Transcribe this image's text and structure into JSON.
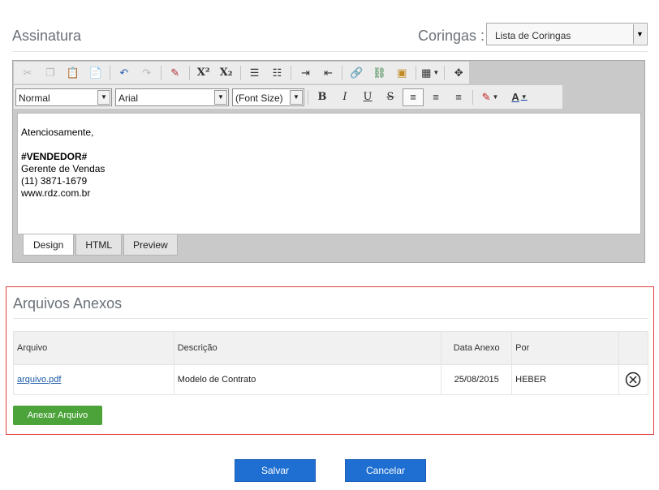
{
  "signature": {
    "title": "Assinatura",
    "coringas_label": "Coringas :",
    "coringas_select": "Lista de Coringas"
  },
  "editor": {
    "format_select": "Normal",
    "font_select": "Arial",
    "size_select": "(Font Size)",
    "content": {
      "line1": "Atenciosamente,",
      "line2": "#VENDEDOR#",
      "line3": "Gerente de Vendas",
      "line4": "(11) 3871-1679",
      "line5": "www.rdz.com.br"
    },
    "tabs": [
      "Design",
      "HTML",
      "Preview"
    ],
    "active_tab": "Design"
  },
  "attachments": {
    "title": "Arquivos Anexos",
    "columns": [
      "Arquivo",
      "Descrição",
      "Data Anexo",
      "Por",
      ""
    ],
    "rows": [
      {
        "file": "arquivo.pdf",
        "description": "Modelo de Contrato",
        "date": "25/08/2015",
        "by": "HEBER"
      }
    ],
    "add_button": "Anexar Arquivo"
  },
  "footer": {
    "save": "Salvar",
    "cancel": "Cancelar"
  },
  "colors": {
    "primary": "#1e6fd1",
    "success": "#4ba33a",
    "highlight_border": "#e23b3b"
  }
}
